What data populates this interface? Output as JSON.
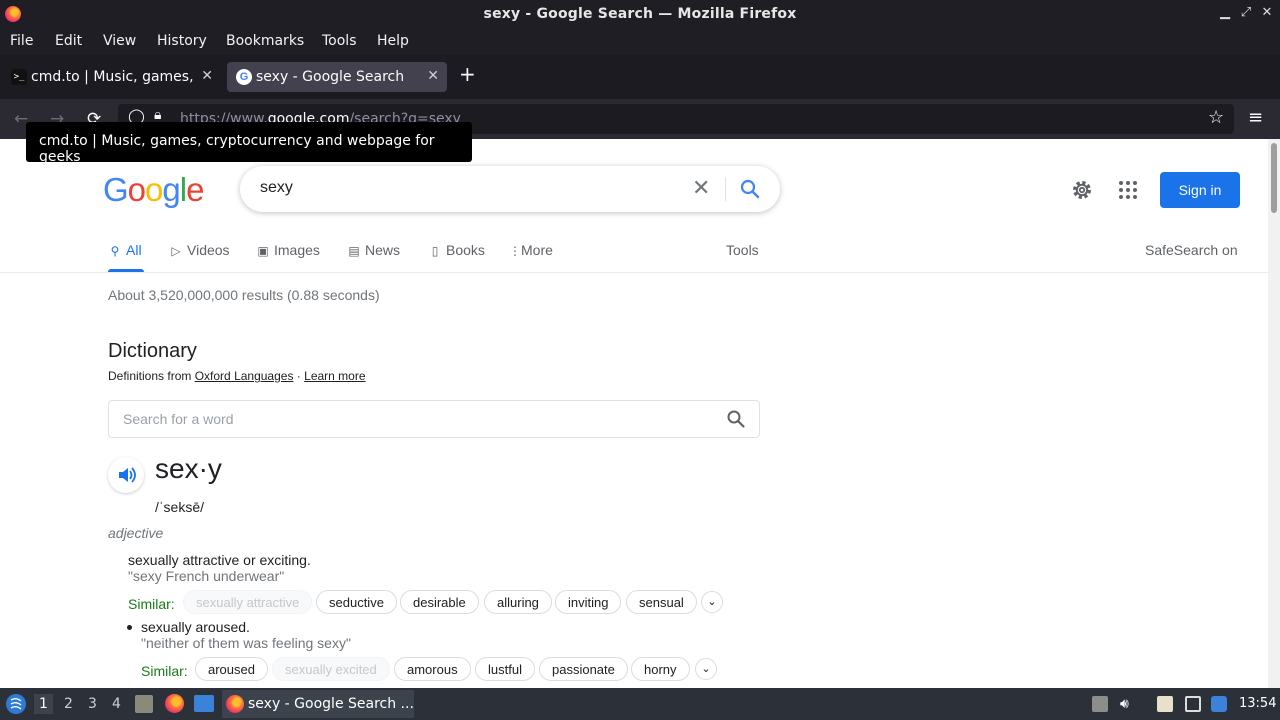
{
  "window": {
    "title": "sexy - Google Search — Mozilla Firefox"
  },
  "menubar": [
    "File",
    "Edit",
    "View",
    "History",
    "Bookmarks",
    "Tools",
    "Help"
  ],
  "tabs": [
    {
      "label": "cmd.to | Music, games, c"
    },
    {
      "label": "sexy - Google Search"
    }
  ],
  "url": {
    "prefix": "https://www.",
    "domain": "google.com",
    "path": "/search?q=sexy"
  },
  "tooltip": "cmd.to | Music, games, cryptocurrency and webpage for geeks",
  "google": {
    "query": "sexy",
    "signin": "Sign in",
    "tabs": [
      "All",
      "Videos",
      "Images",
      "News",
      "Books",
      "More"
    ],
    "tools": "Tools",
    "safesearch": "SafeSearch on",
    "stats": "About 3,520,000,000 results (0.88 seconds)"
  },
  "dictionary": {
    "heading": "Dictionary",
    "source_prefix": "Definitions from",
    "source": "Oxford Languages",
    "learn_more": "Learn more",
    "search_placeholder": "Search for a word",
    "headword": "sex·y",
    "phonetic": "/ˈseksē/",
    "pos": "adjective",
    "senses": [
      {
        "definition": "sexually attractive or exciting.",
        "example": "\"sexy French underwear\"",
        "similar_label": "Similar:",
        "similar": [
          "sexually attractive",
          "seductive",
          "desirable",
          "alluring",
          "inviting",
          "sensual"
        ]
      },
      {
        "definition": "sexually aroused.",
        "example": "\"neither of them was feeling sexy\"",
        "similar_label": "Similar:",
        "similar": [
          "aroused",
          "sexually excited",
          "amorous",
          "lustful",
          "passionate",
          "horny"
        ]
      }
    ]
  },
  "taskbar": {
    "workspaces": [
      "1",
      "2",
      "3",
      "4"
    ],
    "task": "sexy - Google Search ...",
    "clock": "13:54"
  },
  "colors": {
    "google_blue": "#1a73e8",
    "firefox_dark": "#1c1b22",
    "similar_green": "#1a7c1a"
  }
}
